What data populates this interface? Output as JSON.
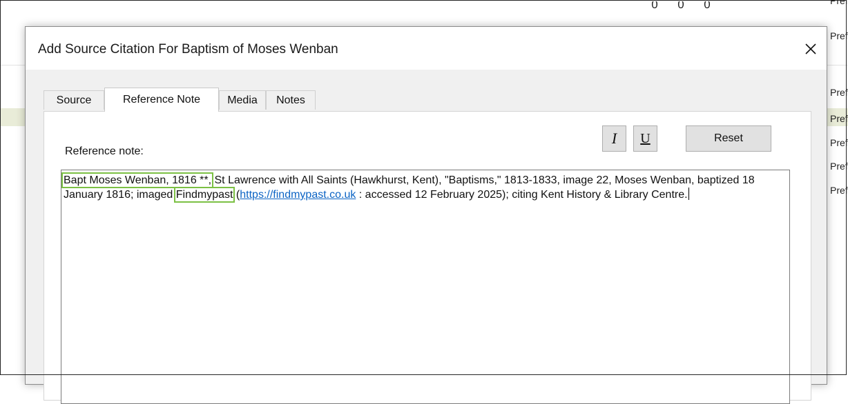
{
  "background": {
    "numbers": [
      "0",
      "0",
      "0"
    ],
    "right_column": [
      "Preferred",
      "Prefer",
      "Prefe",
      "Prefe",
      "Prefe",
      "Prefe",
      "Prefe"
    ],
    "row_highlight_color": "#e9ecd8"
  },
  "dialog": {
    "title": "Add Source Citation For Baptism of Moses Wenban",
    "close_glyph": "✕",
    "tabs": [
      {
        "label": "Source",
        "active": false
      },
      {
        "label": "Reference Note",
        "active": true
      },
      {
        "label": "Media",
        "active": false
      },
      {
        "label": "Notes",
        "active": false
      }
    ],
    "reference_label": "Reference note:",
    "buttons": {
      "italic": "I",
      "underline": "U",
      "reset": "Reset"
    },
    "note": {
      "highlight1": "Bapt Moses Wenban, 1816 **,",
      "text1": " St Lawrence with All Saints (Hawkhurst, Kent), \"Baptisms,\" 1813-1833, image 22, Moses Wenban, baptized 18 January 1816; imaged ",
      "highlight2": "Findmypast",
      "text2": " (",
      "link": "https://findmypast.co.uk",
      "text3": " : accessed 12 February 2025); citing Kent History & Library Centre."
    },
    "highlight_color": "#7bc043"
  }
}
